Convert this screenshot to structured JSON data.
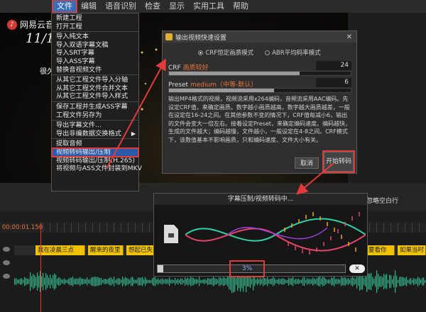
{
  "menubar": {
    "items": [
      "文件",
      "编辑",
      "语音识别",
      "检查",
      "显示",
      "实用工具",
      "帮助"
    ]
  },
  "video": {
    "logo_text": "网易云音",
    "date_text": "11/19",
    "subtitle_text": "很久很久"
  },
  "file_menu": {
    "items": [
      {
        "label": "新建工程"
      },
      {
        "label": "打开工程"
      },
      {
        "label": "导入纯文本"
      },
      {
        "label": "导入双语字幕文稿"
      },
      {
        "label": "导入SRT字幕"
      },
      {
        "label": "导入ASS字幕"
      },
      {
        "label": "替换音视频文件"
      },
      {
        "label": "从其它工程文件导入分轴"
      },
      {
        "label": "从其它工程文件合并文本"
      },
      {
        "label": "从其它工程文件导入样式"
      },
      {
        "label": "保存工程并生成ASS字幕"
      },
      {
        "label": "工程文件另存为"
      },
      {
        "label": "导出字幕文件..."
      },
      {
        "label": "导出非编数据交换格式"
      },
      {
        "label": "提取音频"
      },
      {
        "label": "视频转码输出/压制"
      },
      {
        "label": "视频转码输出/压制(H.265)"
      },
      {
        "label": "将视频与ASS文件封装到MKV"
      }
    ]
  },
  "dialog": {
    "title": "输出视频快速设置",
    "mode_crf": "CRF恒定画质模式",
    "mode_abr": "ABR平均码率模式",
    "crf_label": "CRF",
    "crf_quality": "画质较好",
    "crf_value": "24",
    "crf_fraction": 0.72,
    "preset_label": "Preset",
    "preset_quality": "medium（中等-默认）",
    "preset_value": "6",
    "preset_fraction": 0.58,
    "description": "输出MP4格式的视频，视频流采用x264编码，音频流采用AAC编码。先设定CRF值，来确定画质。数字越小画质越高，数字越大画质越差，一般在设定在16-24之间。在其他参数不变的情况下，CRF值每减小6，输出的文件会变大一倍左右。接着设定Preset，来确定编码速度。编码越快，生成的文件越大；编码越慢，文件越小，一般设定在4-8之间。CRF模式下，该数值基本不影响画质，只和编码速度、文件大小有关。",
    "cancel_label": "取消",
    "start_label": "开始转码",
    "close_glyph": "✕"
  },
  "progress": {
    "title": "字幕压制/视频转码中...",
    "percent_text": "3%",
    "fraction": 0.03,
    "cancel_glyph": "✕"
  },
  "timeline": {
    "timecode": "00:00:01.150",
    "ignore_blank_label": "忽略空白行",
    "clips": [
      {
        "text": "我在凌晨三点"
      },
      {
        "text": "醒来的夜里"
      },
      {
        "text": "想起已失"
      },
      {
        "text": "要看你"
      },
      {
        "text": "如果当时"
      }
    ]
  },
  "colors": {
    "accent_red": "#e23a3a",
    "menu_highlight": "#2b5aa8",
    "clip_yellow": "#f0c200",
    "wave_green": "#2fb58a"
  }
}
